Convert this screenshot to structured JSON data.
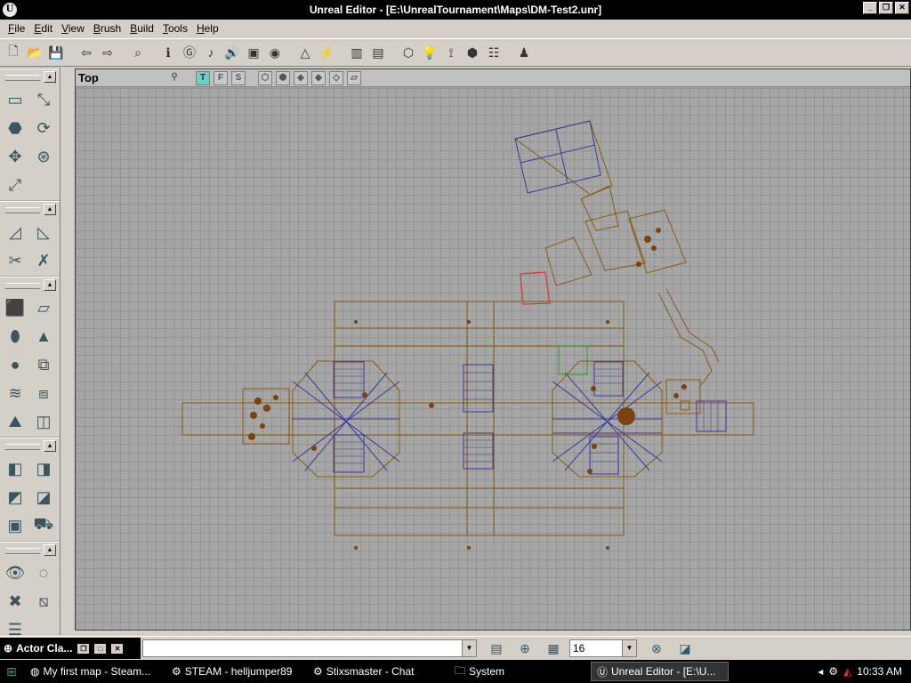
{
  "window": {
    "title": "Unreal Editor - [E:\\UnrealTournament\\Maps\\DM-Test2.unr]",
    "app_icon": "U"
  },
  "menu": [
    "File",
    "Edit",
    "View",
    "Brush",
    "Build",
    "Tools",
    "Help"
  ],
  "viewport": {
    "title": "Top",
    "view_modes": [
      "T",
      "F",
      "S"
    ]
  },
  "status": {
    "actor_class_label": "Actor Cla...",
    "command_value": "",
    "grid_size": "16"
  },
  "taskbar": {
    "tasks": [
      {
        "label": "My first map - Steam...",
        "icon": "firefox-icon"
      },
      {
        "label": "STEAM - helljumper89",
        "icon": "steam-icon"
      },
      {
        "label": "Stixsmaster - Chat",
        "icon": "steam-icon"
      },
      {
        "label": "System",
        "icon": "folder-icon"
      },
      {
        "label": "Unreal Editor - [E:\\U...",
        "icon": "unreal-icon"
      }
    ],
    "clock": "10:33 AM"
  },
  "colors": {
    "brush_outline": "#8b5a10",
    "sheet_brush": "#3838a0",
    "selected": "#e03030",
    "bg_grid": "#a6a6a6"
  }
}
